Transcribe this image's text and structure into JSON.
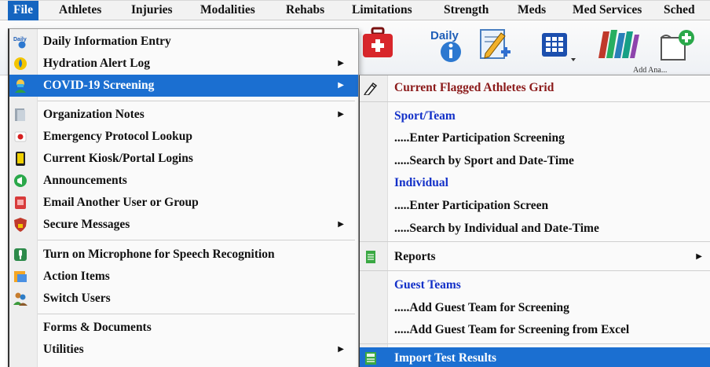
{
  "menubar": {
    "file": "File",
    "athletes": "Athletes",
    "injuries": "Injuries",
    "modalities": "Modalities",
    "rehabs": "Rehabs",
    "limitations": "Limitations",
    "strength": "Strength",
    "meds": "Meds",
    "med_services": "Med Services",
    "sched": "Sched"
  },
  "toolbar": {
    "icons": [
      "first-aid-kit-icon",
      "daily-info-icon",
      "edit-add-icon",
      "grid-icon",
      "books-icon",
      "add-document-icon"
    ],
    "partial_caption_1": "Add Ana..."
  },
  "file_menu": {
    "items": [
      {
        "label": "Daily Information Entry",
        "icon": "daily-icon"
      },
      {
        "label": "Hydration Alert Log",
        "icon": "water-drop-icon",
        "submenu": true
      },
      {
        "label": "COVID-19 Screening",
        "icon": "person-mask-icon",
        "submenu": true,
        "highlighted": true
      },
      {
        "label": "Organization Notes",
        "icon": "notes-icon",
        "submenu": true
      },
      {
        "label": "Emergency Protocol Lookup",
        "icon": "emergency-icon"
      },
      {
        "label": "Current Kiosk/Portal Logins",
        "icon": "kiosk-icon"
      },
      {
        "label": "Announcements",
        "icon": "announcement-icon"
      },
      {
        "label": "Email Another User or Group",
        "icon": "email-icon"
      },
      {
        "label": "Secure Messages",
        "icon": "lock-shield-icon",
        "submenu": true
      },
      {
        "label": "Turn on Microphone for Speech Recognition",
        "icon": "microphone-icon"
      },
      {
        "label": "Action Items",
        "icon": "action-items-icon"
      },
      {
        "label": "Switch Users",
        "icon": "switch-users-icon"
      },
      {
        "label": "Forms & Documents"
      },
      {
        "label": "Utilities",
        "submenu": true
      }
    ]
  },
  "covid_submenu": {
    "items": [
      {
        "label": "Current Flagged Athletes Grid",
        "icon": "pencil-icon",
        "style": "maroon"
      },
      {
        "label": "Sport/Team",
        "style": "section"
      },
      {
        "label": ".....Enter Participation Screening"
      },
      {
        "label": ".....Search by Sport and Date-Time"
      },
      {
        "label": "Individual",
        "style": "section"
      },
      {
        "label": ".....Enter Participation Screen"
      },
      {
        "label": ".....Search by Individual and Date-Time"
      },
      {
        "label": "Reports",
        "icon": "reports-icon",
        "submenu": true
      },
      {
        "label": "Guest Teams",
        "style": "section"
      },
      {
        "label": ".....Add Guest Team for Screening"
      },
      {
        "label": ".....Add Guest Team for Screening from Excel"
      },
      {
        "label": "Import Test Results",
        "icon": "import-icon",
        "highlighted": true
      }
    ]
  },
  "colors": {
    "highlight": "#1b6fd1",
    "menubar_active": "#1565c0",
    "section_blue": "#1230c8",
    "maroon": "#8b1a1a"
  }
}
